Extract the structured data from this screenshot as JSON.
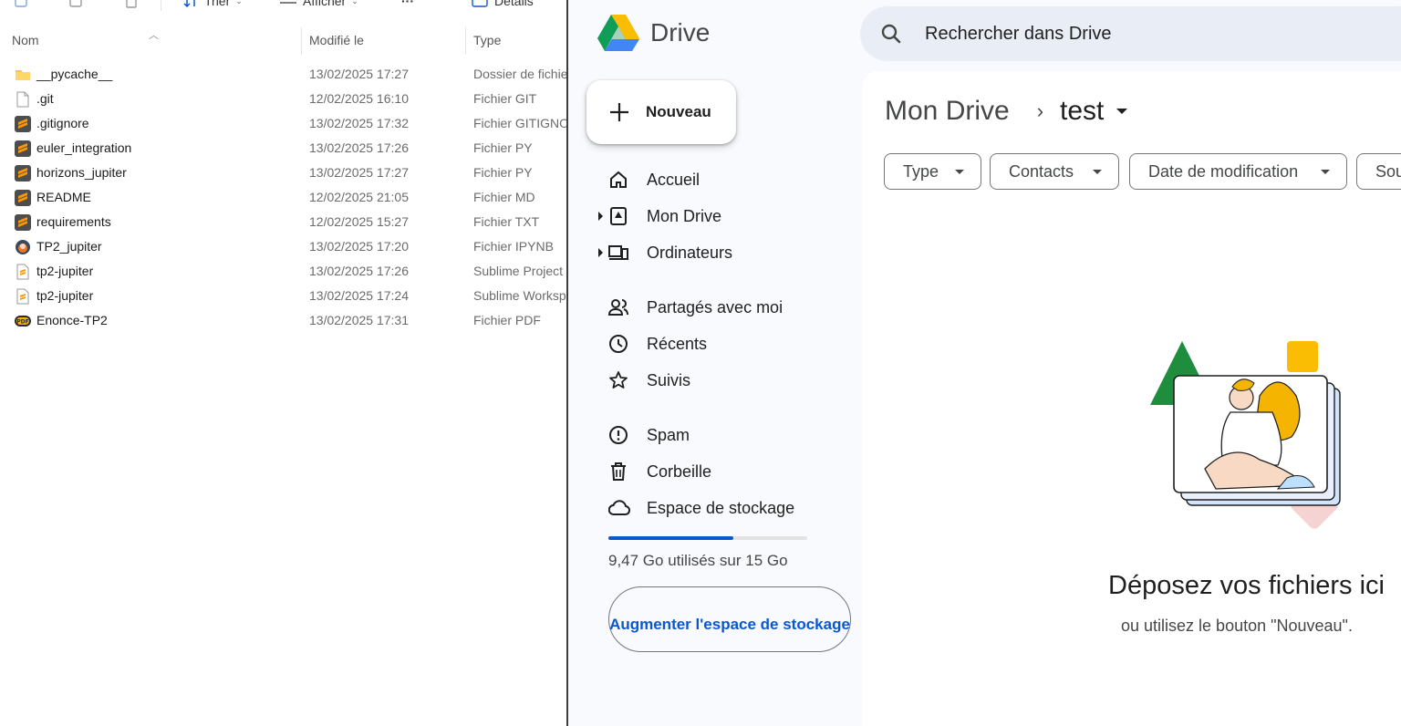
{
  "explorer": {
    "toolbar": {
      "sort_label": "Trier",
      "view_label": "Afficher",
      "more_label": "···",
      "details_label": "Détails"
    },
    "columns": {
      "name": "Nom",
      "modified": "Modifié le",
      "type": "Type"
    },
    "files": [
      {
        "name": "__pycache__",
        "date": "13/02/2025 17:27",
        "type": "Dossier de fichiers",
        "icon": "folder-icon"
      },
      {
        "name": ".git",
        "date": "12/02/2025 16:10",
        "type": "Fichier GIT",
        "icon": "blank-file-icon"
      },
      {
        "name": ".gitignore",
        "date": "13/02/2025 17:32",
        "type": "Fichier GITIGNORE",
        "icon": "sublime-file-icon"
      },
      {
        "name": "euler_integration",
        "date": "13/02/2025 17:26",
        "type": "Fichier PY",
        "icon": "sublime-file-icon"
      },
      {
        "name": "horizons_jupiter",
        "date": "13/02/2025 17:27",
        "type": "Fichier PY",
        "icon": "sublime-file-icon"
      },
      {
        "name": "README",
        "date": "12/02/2025 21:05",
        "type": "Fichier MD",
        "icon": "sublime-file-icon"
      },
      {
        "name": "requirements",
        "date": "12/02/2025 15:27",
        "type": "Fichier TXT",
        "icon": "sublime-file-icon"
      },
      {
        "name": "TP2_jupiter",
        "date": "13/02/2025 17:20",
        "type": "Fichier IPYNB",
        "icon": "jupyter-file-icon"
      },
      {
        "name": "tp2-jupiter",
        "date": "13/02/2025 17:26",
        "type": "Sublime Project",
        "icon": "sublime-project-icon"
      },
      {
        "name": "tp2-jupiter",
        "date": "13/02/2025 17:24",
        "type": "Sublime Workspace",
        "icon": "sublime-project-icon"
      },
      {
        "name": "Enonce-TP2",
        "date": "13/02/2025 17:31",
        "type": "Fichier PDF",
        "icon": "pdf-file-icon"
      }
    ]
  },
  "drive": {
    "logo_text": "Drive",
    "search_placeholder": "Rechercher dans Drive",
    "new_button": "Nouveau",
    "nav": [
      {
        "label": "Accueil",
        "icon": "home-icon",
        "expand": false
      },
      {
        "label": "Mon Drive",
        "icon": "my-drive-icon",
        "expand": true
      },
      {
        "label": "Ordinateurs",
        "icon": "computers-icon",
        "expand": true
      },
      {
        "label": "Partagés avec moi",
        "icon": "shared-icon",
        "expand": false
      },
      {
        "label": "Récents",
        "icon": "clock-icon",
        "expand": false
      },
      {
        "label": "Suivis",
        "icon": "star-icon",
        "expand": false
      },
      {
        "label": "Spam",
        "icon": "spam-icon",
        "expand": false
      },
      {
        "label": "Corbeille",
        "icon": "trash-icon",
        "expand": false
      },
      {
        "label": "Espace de stockage",
        "icon": "cloud-icon",
        "expand": false
      }
    ],
    "storage": {
      "used_fraction": 0.63,
      "text": "9,47 Go utilisés sur 15 Go",
      "upgrade_button": "Augmenter l'espace de stockage"
    },
    "breadcrumb": {
      "root": "Mon Drive",
      "separator": "›",
      "current": "test"
    },
    "filters": [
      "Type",
      "Contacts",
      "Date de modification",
      "Source"
    ],
    "empty_state": {
      "title": "Déposez vos fichiers ici",
      "subtitle": "ou utilisez le bouton \"Nouveau\"."
    },
    "colors": {
      "accent_blue": "#0b57d0",
      "sidebar_bg": "#f8fafd",
      "search_bg": "#e9eef6"
    }
  }
}
